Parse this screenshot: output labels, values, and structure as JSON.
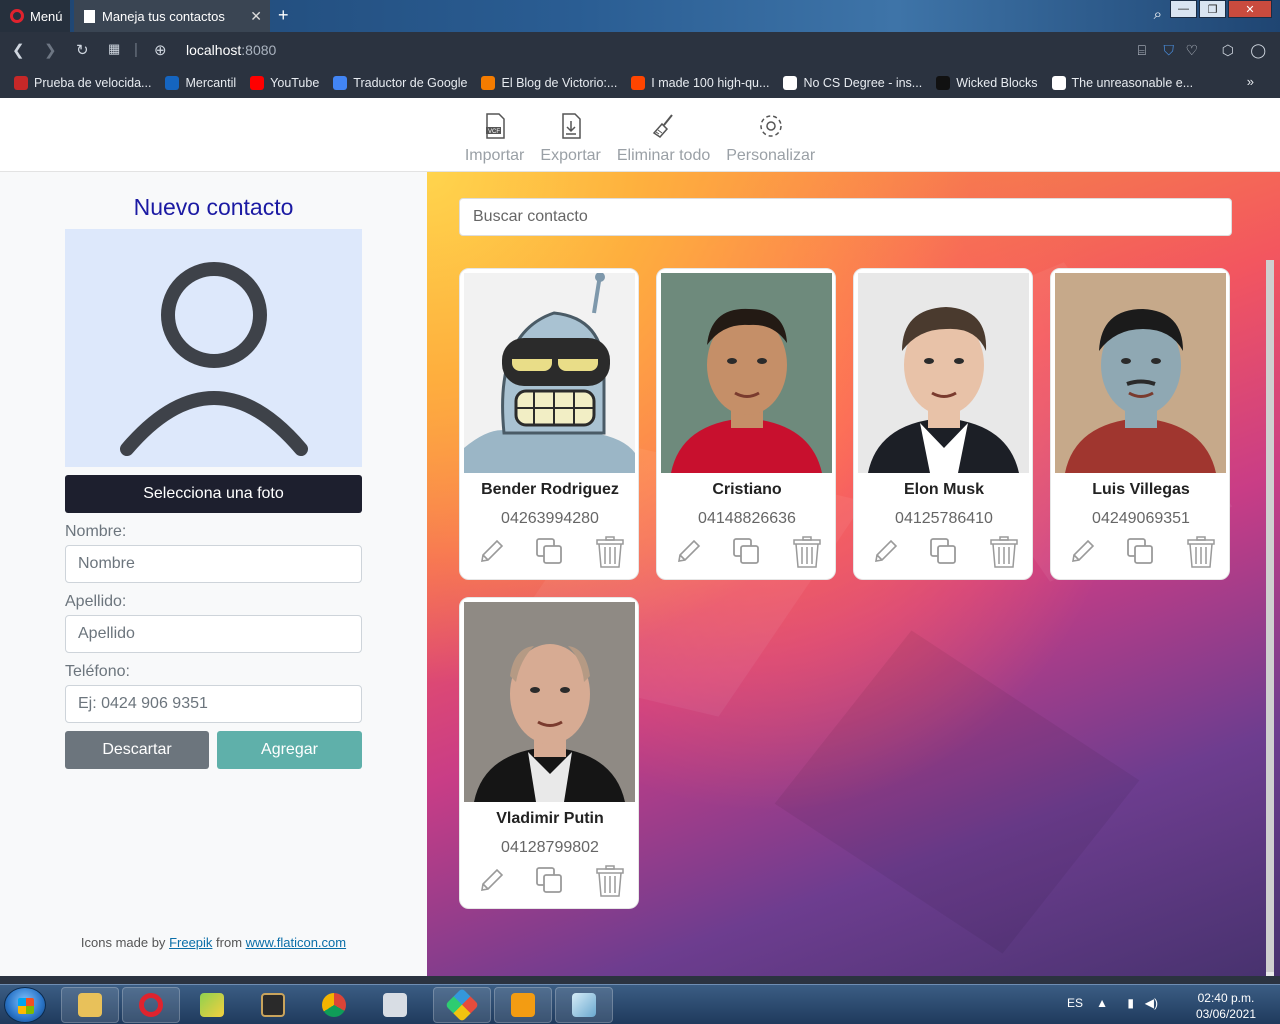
{
  "browser": {
    "menu_label": "Menú",
    "tab_title": "Maneja tus contactos",
    "url_host": "localhost",
    "url_port": ":8080",
    "bookmarks": [
      {
        "label": "Prueba de velocida...",
        "color": "#c62828"
      },
      {
        "label": "Mercantil",
        "color": "#1565c0"
      },
      {
        "label": "YouTube",
        "color": "#ff0000"
      },
      {
        "label": "Traductor de Google",
        "color": "#4285f4"
      },
      {
        "label": "El Blog de Victorio:...",
        "color": "#f57c00"
      },
      {
        "label": "I made 100 high-qu...",
        "color": "#ff4500"
      },
      {
        "label": "No CS Degree - ins...",
        "color": "#ffffff"
      },
      {
        "label": "Wicked Blocks",
        "color": "#111111"
      },
      {
        "label": "The unreasonable e...",
        "color": "#ffffff"
      }
    ],
    "bookmarks_more": "»"
  },
  "toolbar": {
    "items": [
      {
        "label": "Importar",
        "icon": "vcf-file-icon"
      },
      {
        "label": "Exportar",
        "icon": "download-file-icon"
      },
      {
        "label": "Eliminar todo",
        "icon": "broom-icon"
      },
      {
        "label": "Personalizar",
        "icon": "gear-icon"
      }
    ]
  },
  "form": {
    "title": "Nuevo contacto",
    "photo_button": "Selecciona una foto",
    "first_name_label": "Nombre:",
    "first_name_placeholder": "Nombre",
    "last_name_label": "Apellido:",
    "last_name_placeholder": "Apellido",
    "phone_label": "Teléfono:",
    "phone_placeholder": "Ej: 0424 906 9351",
    "discard_label": "Descartar",
    "add_label": "Agregar",
    "credit_prefix": "Icons made by",
    "credit_author": "Freepik",
    "credit_middle": "from",
    "credit_site": "www.flaticon.com"
  },
  "search": {
    "placeholder": "Buscar contacto"
  },
  "contacts": [
    {
      "name": "Bender Rodriguez",
      "phone": "04263994280",
      "photo": "bender"
    },
    {
      "name": "Cristiano",
      "phone": "04148826636",
      "photo": "cristiano"
    },
    {
      "name": "Elon Musk",
      "phone": "04125786410",
      "photo": "elon"
    },
    {
      "name": "Luis Villegas",
      "phone": "04249069351",
      "photo": "luis"
    },
    {
      "name": "Vladimir Putin",
      "phone": "04128799802",
      "photo": "putin"
    }
  ],
  "taskbar": {
    "lang": "ES",
    "time": "02:40 p.m.",
    "date": "03/06/2021"
  },
  "colors": {
    "title": "#1b1aa3",
    "add_button": "#5fb0aa",
    "discard_button": "#6c757d",
    "photo_button": "#1d1f2e"
  }
}
